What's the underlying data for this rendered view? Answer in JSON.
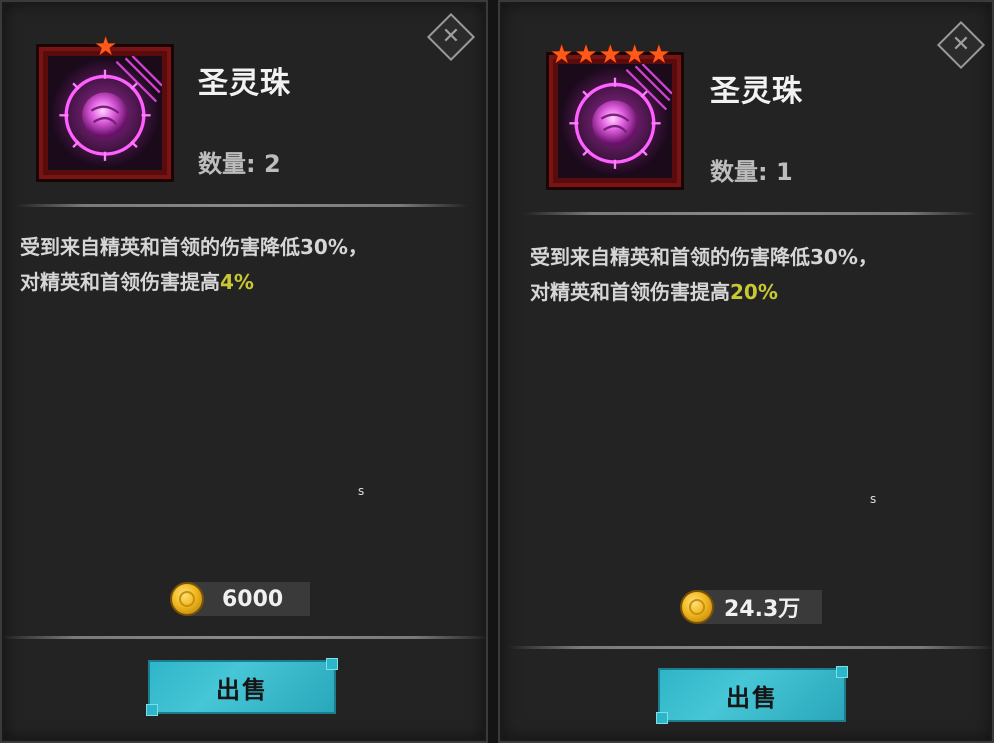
{
  "panels": [
    {
      "name": "圣灵珠",
      "stars": 1,
      "quantity": "数量: 2",
      "description_line1": "受到来自精英和首领的伤害降低30%，",
      "description_line2_prefix": "对精英和首领伤害提高",
      "description_highlight": "4%",
      "marker": "s",
      "price": "6000",
      "sell_label": "出售",
      "star_glyph": "★",
      "close_glyph": "✕",
      "icon": "pink-orb-icon"
    },
    {
      "name": "圣灵珠",
      "stars": 5,
      "quantity": "数量: 1",
      "description_line1": "受到来自精英和首领的伤害降低30%，",
      "description_line2_prefix": "对精英和首领伤害提高",
      "description_highlight": "20%",
      "marker": "s",
      "price": "24.3万",
      "sell_label": "出售",
      "star_glyph": "★",
      "close_glyph": "✕",
      "icon": "pink-orb-icon"
    }
  ],
  "colors": {
    "highlight": "#c8c832",
    "star": "#ff5a1a",
    "sell_button": "#2fb5c8",
    "icon_frame": "#5a0c0c",
    "orb": "#e040e0"
  }
}
